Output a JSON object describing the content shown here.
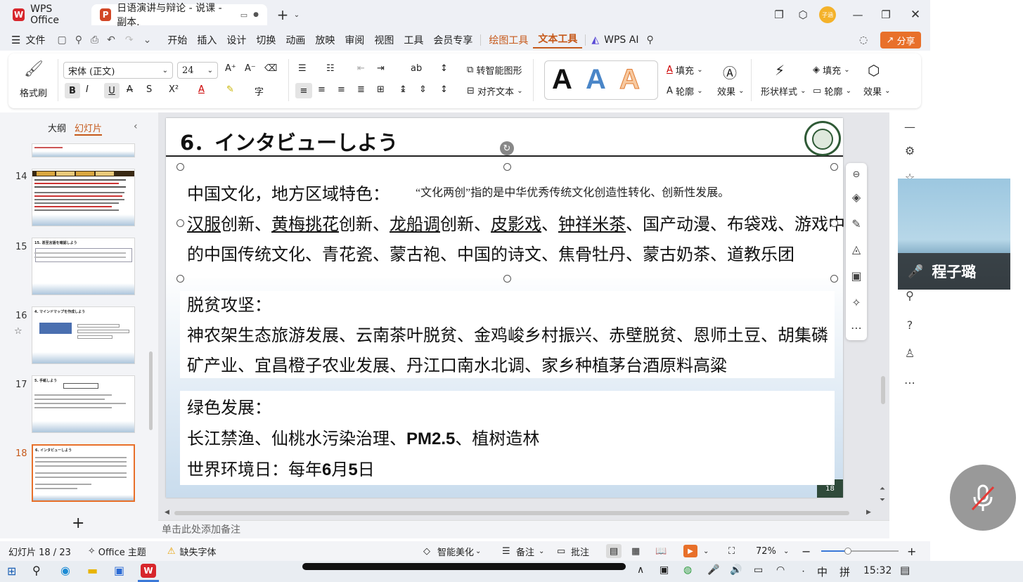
{
  "titlebar": {
    "home_tab": "WPS Office",
    "doc_tab": "日语演讲与辩论 - 说课 - 副本.",
    "avatar": "子涵"
  },
  "menubar": {
    "file": "文件",
    "items": [
      "开始",
      "插入",
      "设计",
      "切换",
      "动画",
      "放映",
      "审阅",
      "视图",
      "工具",
      "会员专享"
    ],
    "drawing_tools": "绘图工具",
    "text_tools": "文本工具",
    "wps_ai": "WPS AI",
    "share": "分享"
  },
  "ribbon": {
    "format_painter": "格式刷",
    "font_name": "宋体 (正文)",
    "font_size": "24",
    "smart_shape": "转智能图形",
    "align_text": "对齐文本",
    "fill": "填充",
    "outline": "轮廓",
    "effect": "效果",
    "shape_style": "形状样式",
    "fill2": "填充",
    "outline2": "轮廓",
    "effect2": "效果",
    "text_style_letter": "A"
  },
  "leftpanel": {
    "outline_tab": "大纲",
    "slides_tab": "幻灯片",
    "slide_numbers": [
      "14",
      "15",
      "16",
      "17",
      "18"
    ],
    "thumb_titles": [
      "",
      "15. 甚至言語を確認しよう",
      "4. マインドマップを作成しよう",
      "5. 手紙しよう",
      "6. インタビューしよう"
    ],
    "add": "+"
  },
  "slide": {
    "title": "6．インタビューしよう",
    "page_number": "18",
    "note_text": "“文化两创”指的是中华优秀传统文化创造性转化、创新性发展。",
    "box1_heading": "中国文化，地方区域特色：",
    "box1_line1": {
      "p1": "汉服",
      "p2": "创新、",
      "p3": "黄梅挑花",
      "p4": "创新、",
      "p5": "龙船调",
      "p6": "创新、",
      "p7": "皮影戏",
      "p8": "、",
      "p9": "钟祥米茶",
      "p10": "、国产动漫、布袋戏、游戏中"
    },
    "box1_line2": "的中国传统文化、青花瓷、蒙古袍、中国的诗文、焦骨牡丹、蒙古奶茶、道教乐团",
    "box2_heading": "脱贫攻坚：",
    "box2_line1": "神农架生态旅游发展、云南茶叶脱贫、金鸡峻乡村振兴、赤壁脱贫、恩师土豆、胡集磷",
    "box2_line2": "矿产业、宜昌橙子农业发展、丹江口南水北调、家乡种植茅台酒原料高粱",
    "box3_heading": "绿色发展：",
    "box3_line1_a": "长江禁渔、仙桃水污染治理、",
    "box3_line1_b": "PM2.5",
    "box3_line1_c": "、植树造林",
    "box3_line2_a": "世界环境日：每年",
    "box3_line2_b": "6",
    "box3_line2_c": "月",
    "box3_line2_d": "5",
    "box3_line2_e": "日"
  },
  "notes_placeholder": "单击此处添加备注",
  "video": {
    "name": "程子璐"
  },
  "statusbar": {
    "slide_count": "幻灯片 18 / 23",
    "theme": "Office 主题",
    "missing_font": "缺失字体",
    "beautify": "智能美化",
    "notes": "备注",
    "comments": "批注",
    "zoom": "72%"
  },
  "taskbar": {
    "ime1": "中",
    "ime2": "拼",
    "time": "15:32"
  }
}
